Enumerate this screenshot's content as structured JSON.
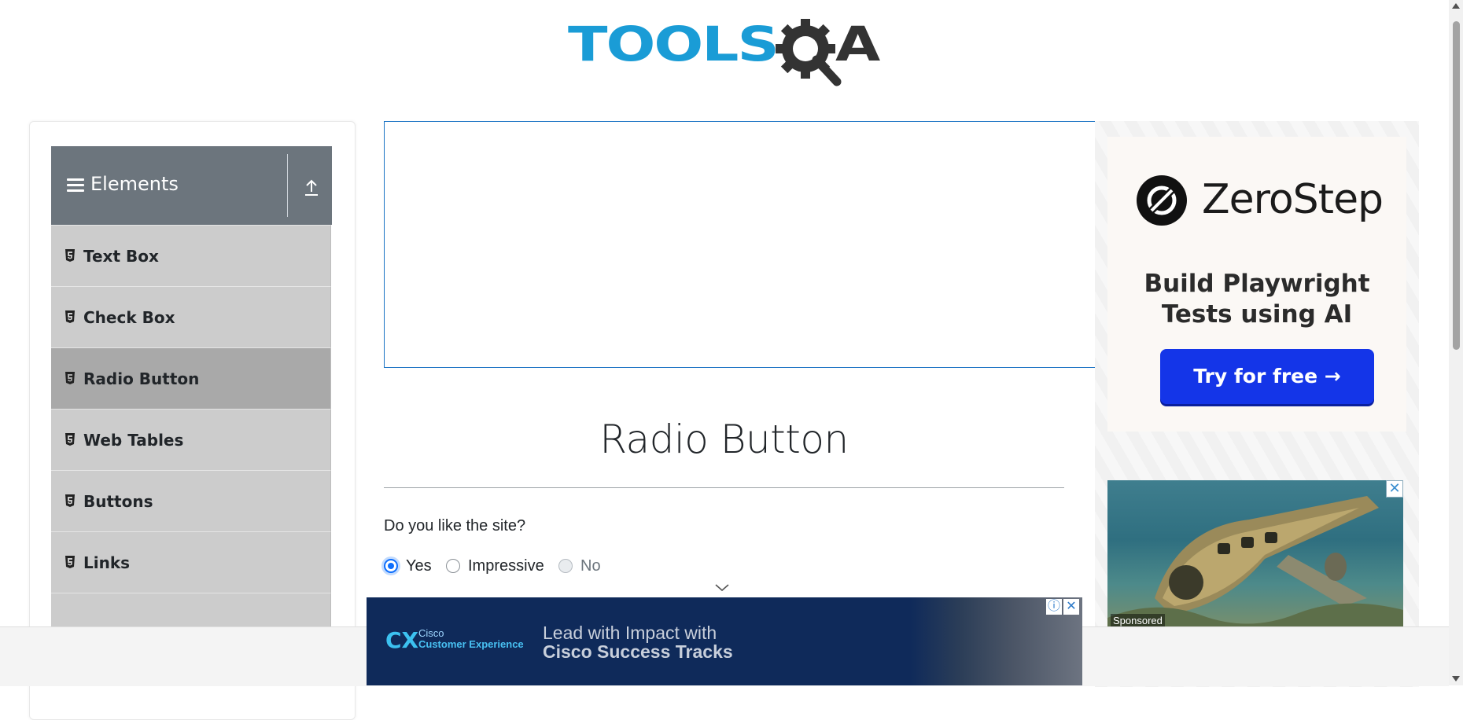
{
  "header": {
    "logo_text": "TOOLS",
    "logo_suffix": "A",
    "logo_icon": "gear-magnifier-icon"
  },
  "sidebar": {
    "group_title": "Elements",
    "group_icon": "hamburger-icon",
    "collapse_icon": "upload-arrow-icon",
    "items": [
      {
        "label": "Text Box",
        "icon": "html5-icon"
      },
      {
        "label": "Check Box",
        "icon": "html5-icon"
      },
      {
        "label": "Radio Button",
        "icon": "html5-icon",
        "active": true
      },
      {
        "label": "Web Tables",
        "icon": "html5-icon"
      },
      {
        "label": "Buttons",
        "icon": "html5-icon"
      },
      {
        "label": "Links",
        "icon": "html5-icon"
      }
    ]
  },
  "main": {
    "title": "Radio Button",
    "question": "Do you like the site?",
    "options": [
      {
        "label": "Yes",
        "checked": true,
        "disabled": false
      },
      {
        "label": "Impressive",
        "checked": false,
        "disabled": false
      },
      {
        "label": "No",
        "checked": false,
        "disabled": true
      }
    ]
  },
  "ads": {
    "zerostep": {
      "brand": "ZeroStep",
      "headline_line1": "Build Playwright",
      "headline_line2": "Tests using AI",
      "button": "Try for free →"
    },
    "plane": {
      "sponsored": "Sponsored",
      "close": "✕"
    },
    "cisco": {
      "logo": "CX",
      "sub1": "Cisco",
      "sub2": "Customer Experience",
      "line1": "Lead with Impact with",
      "line2": "Cisco Success Tracks",
      "info": "ⓘ",
      "close": "✕"
    }
  },
  "colors": {
    "accent": "#0d6efd",
    "sidebar_header": "#6c757d",
    "menu_item": "#cccccc",
    "menu_active": "#a9a9a9",
    "logo_blue": "#1a9cd6"
  }
}
